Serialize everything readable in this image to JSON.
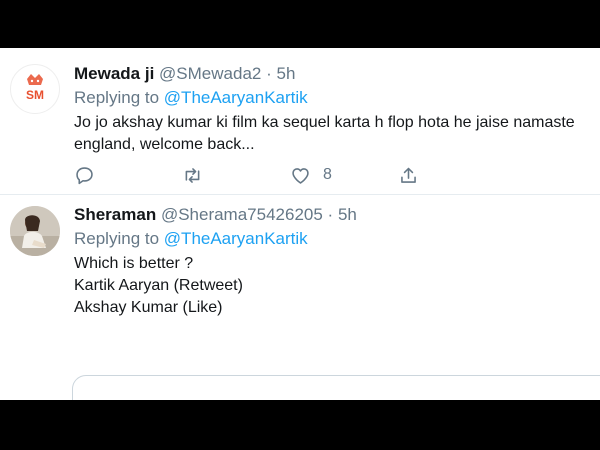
{
  "tweets": [
    {
      "display_name": "Mewada ji",
      "handle": "@SMewada2",
      "separator": "·",
      "time": "5h",
      "replying_prefix": "Replying to",
      "mention": "@TheAaryanKartik",
      "body_lines": [
        "Jo jo akshay kumar ki film ka sequel karta h flop hota he jaise namaste",
        "england, welcome back..."
      ],
      "avatar_text": "SM",
      "avatar_accent": "#e8502f",
      "actions": {
        "reply_count": "",
        "retweet_count": "",
        "like_count": "8"
      }
    },
    {
      "display_name": "Sheraman",
      "handle": "@Sherama75426205",
      "separator": "·",
      "time": "5h",
      "replying_prefix": "Replying to",
      "mention": "@TheAaryanKartik",
      "body_lines": [
        "Which is better ?",
        "Kartik Aaryan (Retweet)",
        "Akshay Kumar (Like)"
      ]
    }
  ],
  "colors": {
    "link": "#1da1f2",
    "secondary_text": "#657786",
    "primary_text": "#14171a",
    "divider": "#e6ecf0",
    "letterbox": "#000000"
  },
  "icons": [
    "reply-icon",
    "retweet-icon",
    "like-icon",
    "share-icon"
  ]
}
